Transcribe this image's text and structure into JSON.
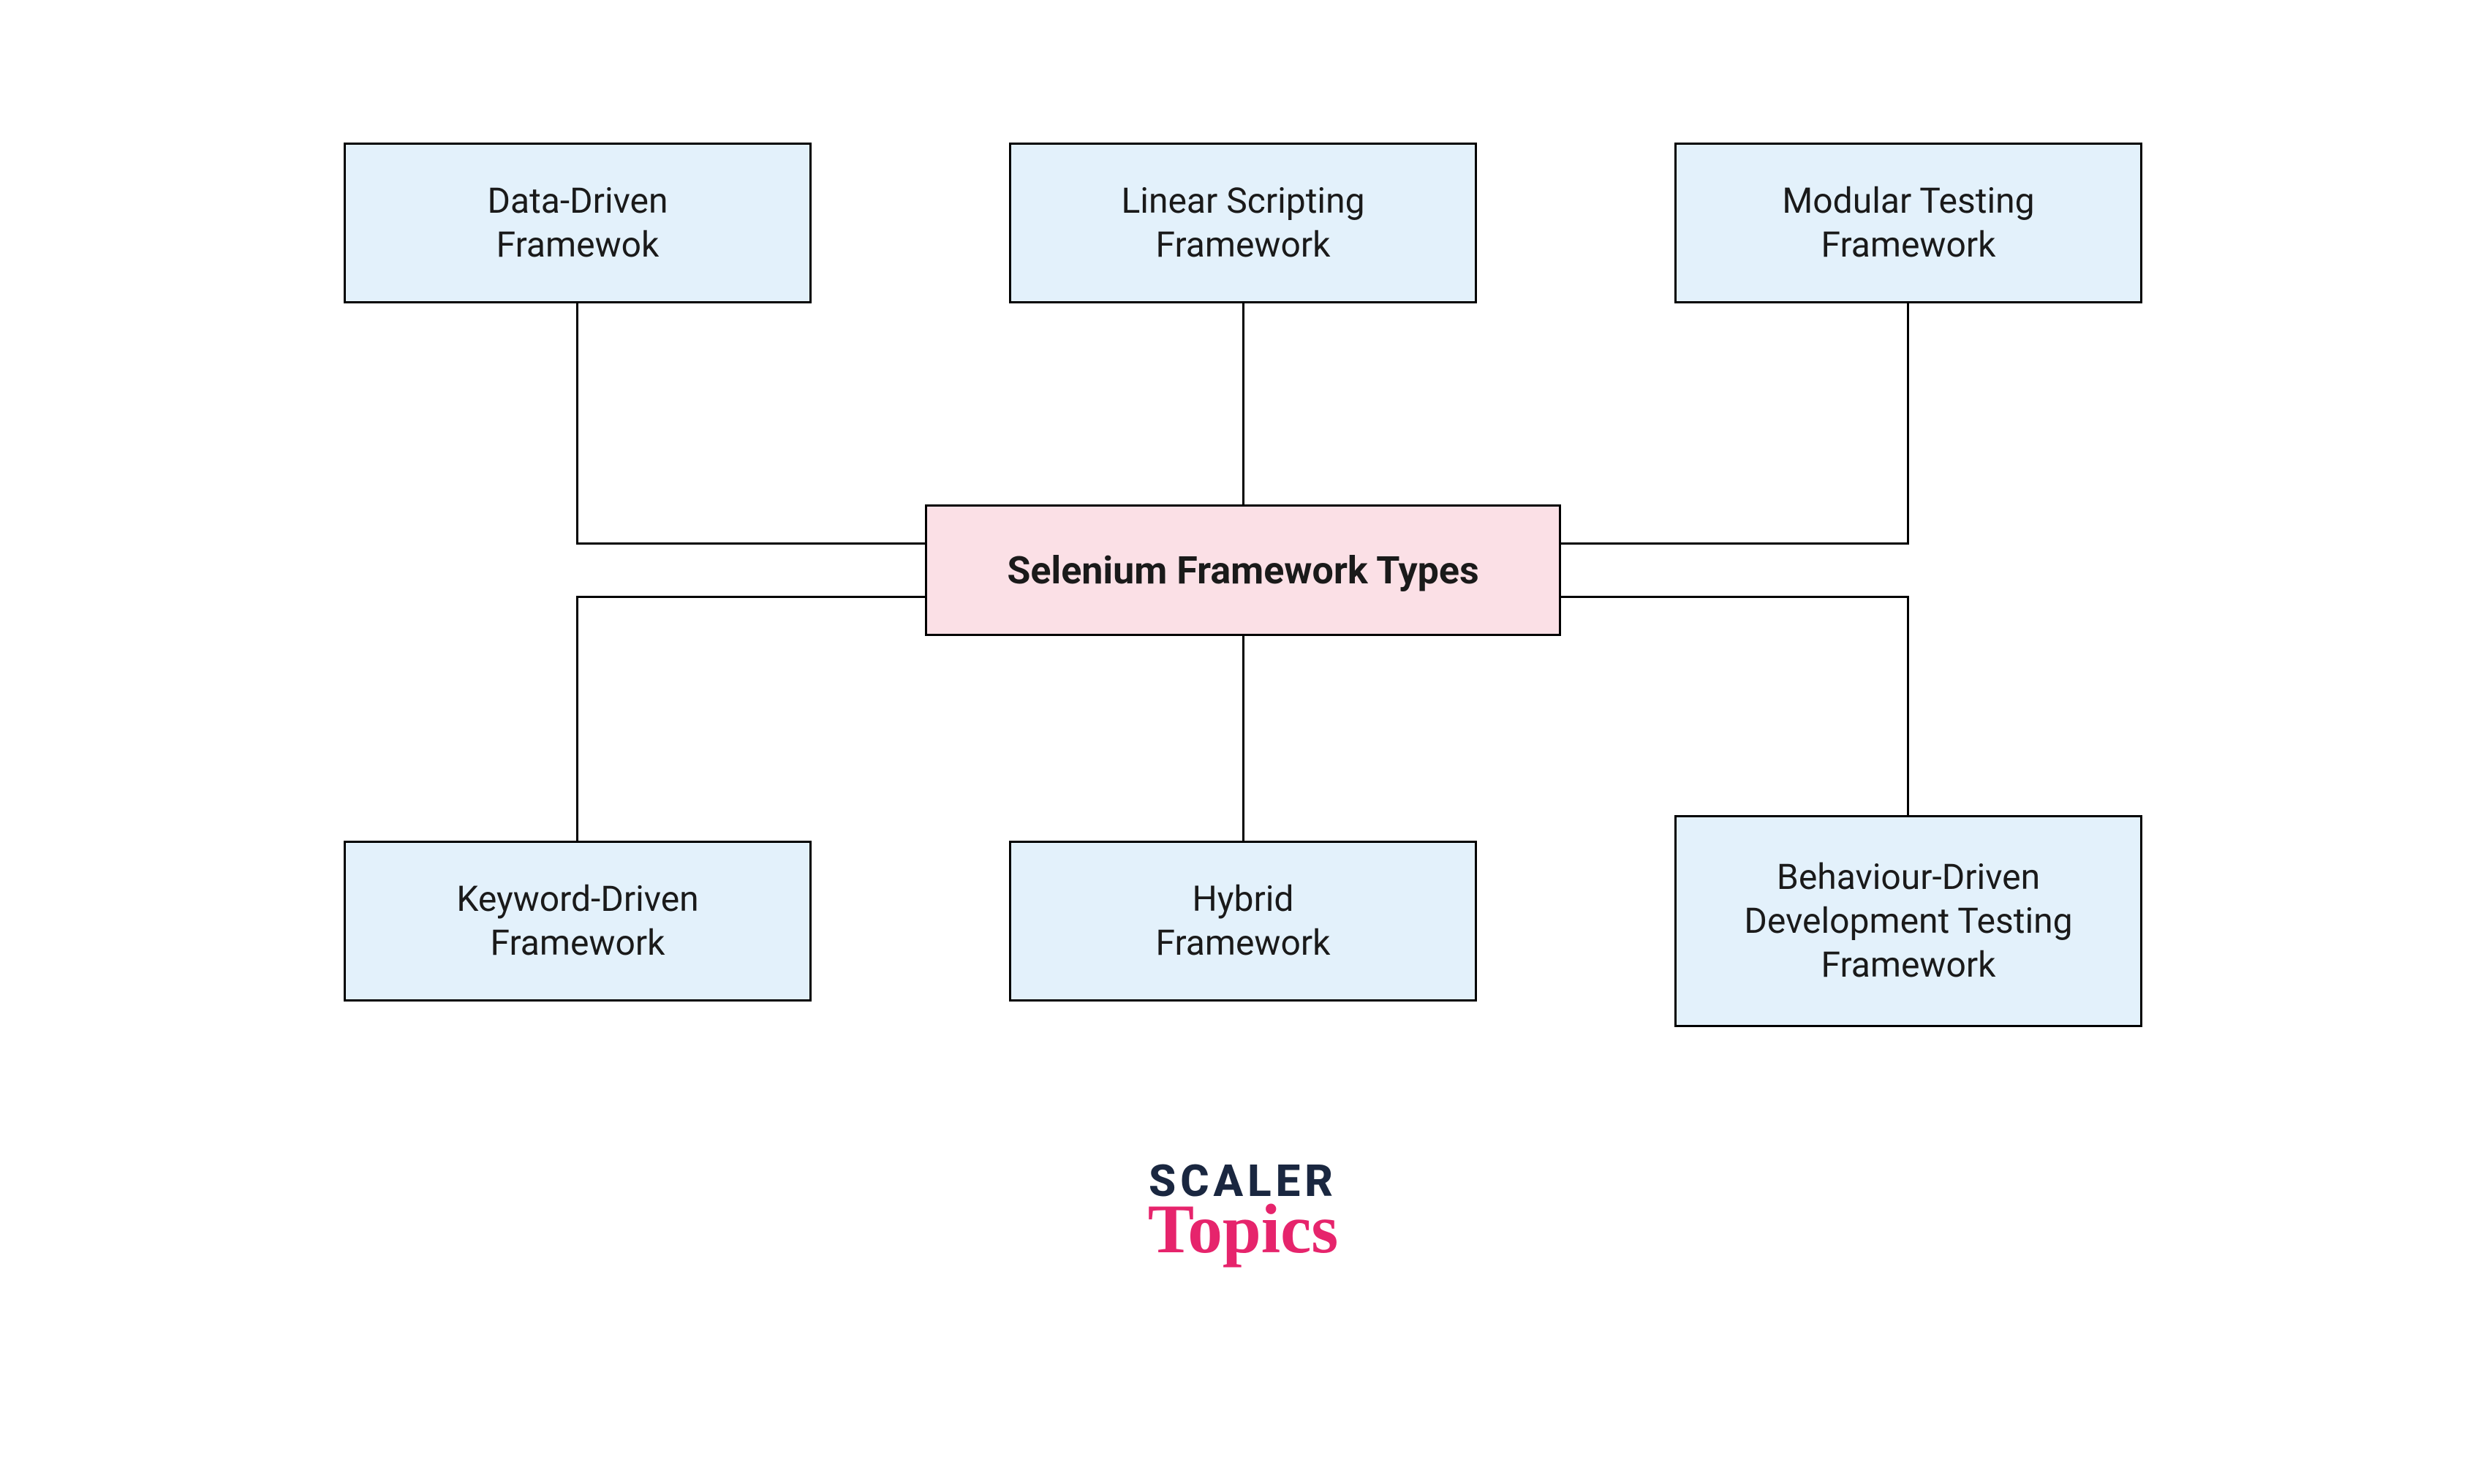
{
  "center": {
    "label": "Selenium Framework Types"
  },
  "top": [
    {
      "label": "Data-Driven\nFramewok"
    },
    {
      "label": "Linear Scripting\nFramework"
    },
    {
      "label": "Modular Testing\nFramework"
    }
  ],
  "bottom": [
    {
      "label": "Keyword-Driven\nFramework"
    },
    {
      "label": "Hybrid\nFramework"
    },
    {
      "label": "Behaviour-Driven\nDevelopment Testing\nFramework"
    }
  ],
  "logo": {
    "top": "SCALER",
    "bottom": "Topics"
  },
  "colors": {
    "childBg": "#e3f1fb",
    "centerBg": "#fbe0e6",
    "border": "#000000",
    "logoDark": "#1a2740",
    "logoPink": "#e6246c"
  }
}
